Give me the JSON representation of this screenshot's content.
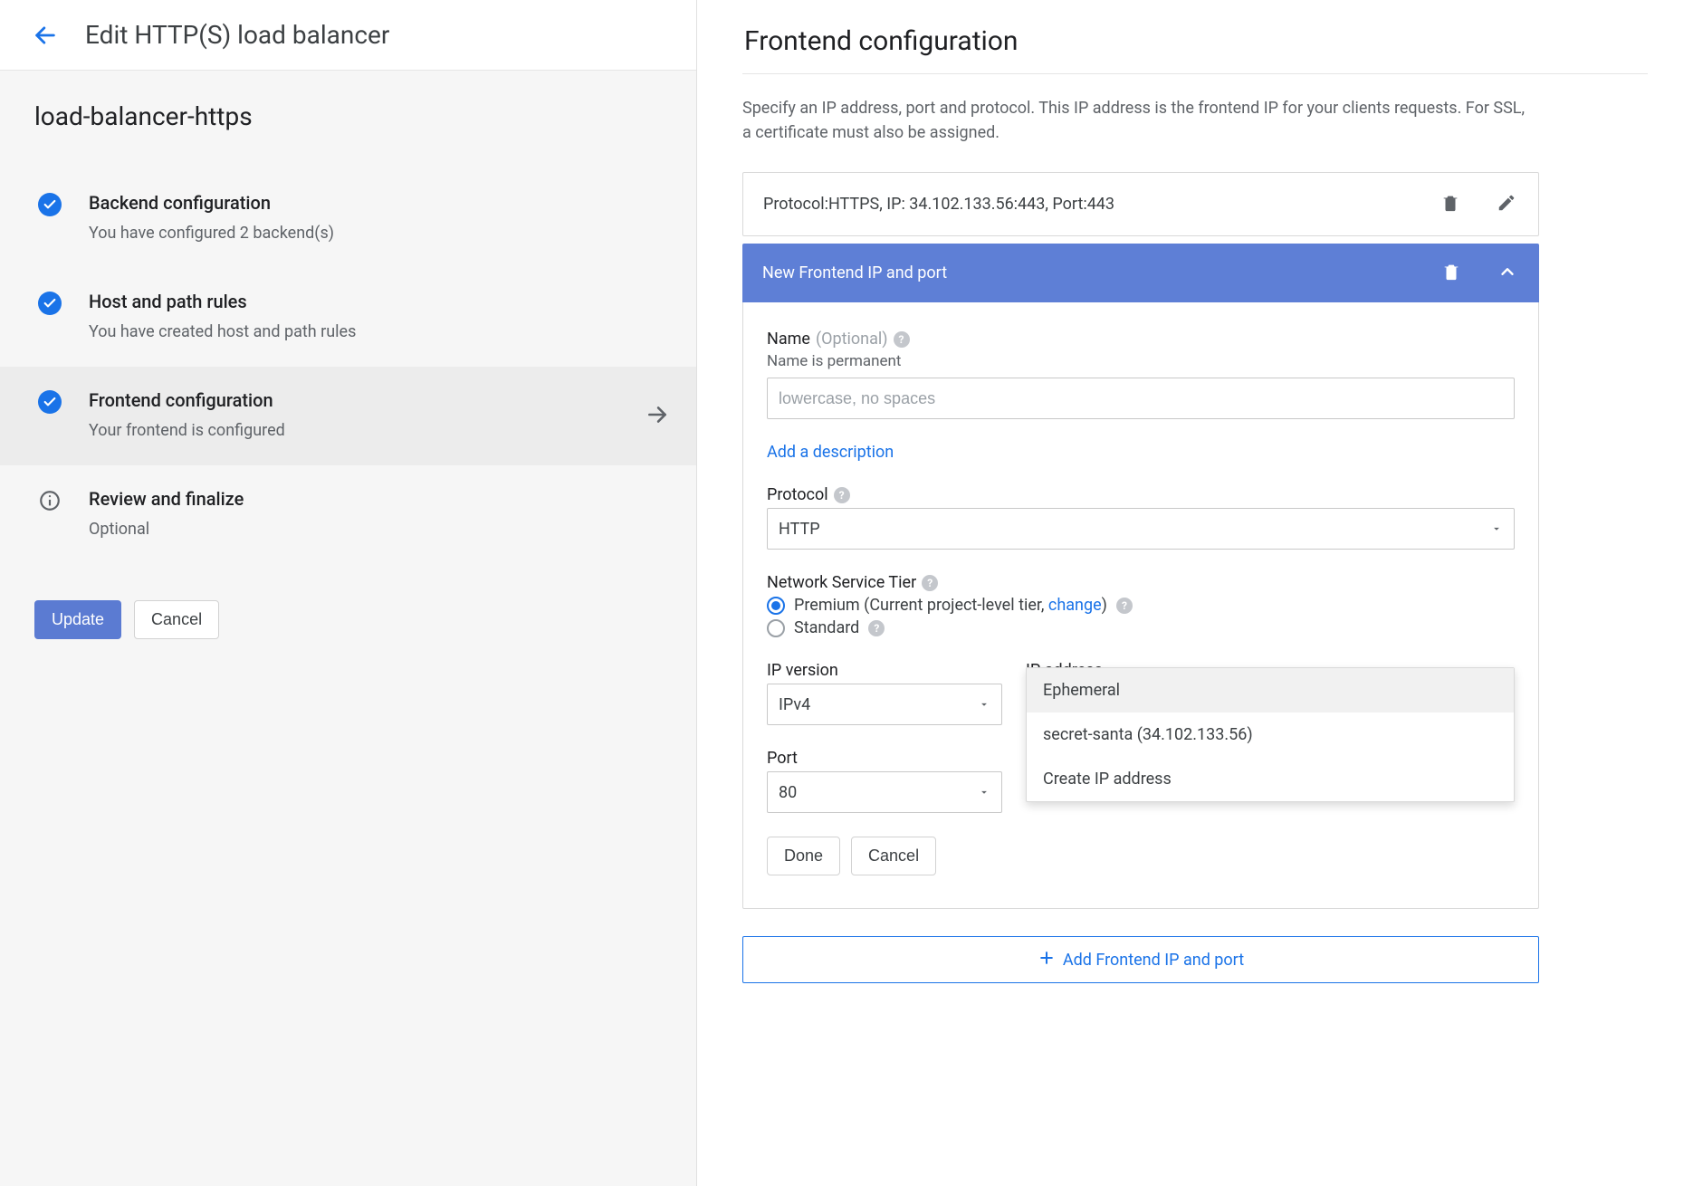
{
  "left": {
    "page_title": "Edit HTTP(S) load balancer",
    "lb_name": "load-balancer-https",
    "steps": {
      "backend": {
        "title": "Backend configuration",
        "sub": "You have configured 2 backend(s)"
      },
      "host": {
        "title": "Host and path rules",
        "sub": "You have created host and path rules"
      },
      "frontend": {
        "title": "Frontend configuration",
        "sub": "Your frontend is configured"
      },
      "review": {
        "title": "Review and finalize",
        "sub": "Optional"
      }
    },
    "actions": {
      "update": "Update",
      "cancel": "Cancel"
    }
  },
  "right": {
    "title": "Frontend configuration",
    "description": "Specify an IP address, port and protocol. This IP address is the frontend IP for your clients requests. For SSL, a certificate must also be assigned.",
    "existing_row": "Protocol:HTTPS, IP: 34.102.133.56:443, Port:443",
    "expand_header": "New Frontend IP and port",
    "form": {
      "name_label": "Name",
      "name_optional": "(Optional)",
      "name_hint": "Name is permanent",
      "name_placeholder": "lowercase, no spaces",
      "add_desc": "Add a description",
      "protocol_label": "Protocol",
      "protocol_value": "HTTP",
      "tier_label": "Network Service Tier",
      "tier_premium": "Premium (Current project-level tier, ",
      "tier_change": "change",
      "tier_premium_tail": ")",
      "tier_standard": "Standard",
      "ipver_label": "IP version",
      "ipver_value": "IPv4",
      "ipaddr_label": "IP address",
      "ip_menu": {
        "ephemeral": "Ephemeral",
        "named": "secret-santa (34.102.133.56)",
        "create": "Create IP address"
      },
      "port_label": "Port",
      "port_value": "80",
      "done": "Done",
      "cancel": "Cancel"
    },
    "add_btn": "Add Frontend IP and port"
  }
}
